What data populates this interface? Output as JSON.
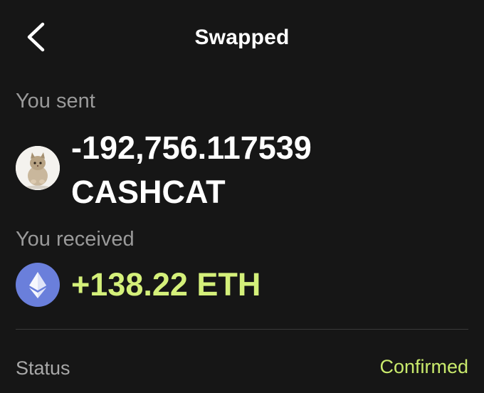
{
  "header": {
    "title": "Swapped",
    "back_icon": "chevron-left-icon"
  },
  "sent": {
    "label": "You sent",
    "amount_line1": "-192,756.117539",
    "amount_line2": "CASHCAT",
    "token_icon": "cat-token-icon"
  },
  "received": {
    "label": "You received",
    "amount": "+138.22 ETH",
    "token_icon": "ethereum-icon",
    "color": "#d4f07a"
  },
  "status": {
    "label": "Status",
    "value": "Confirmed",
    "color": "#c9ea6c"
  },
  "colors": {
    "background": "#161616",
    "eth_badge": "#6a7fdb",
    "muted_text": "#9a9a9a"
  }
}
